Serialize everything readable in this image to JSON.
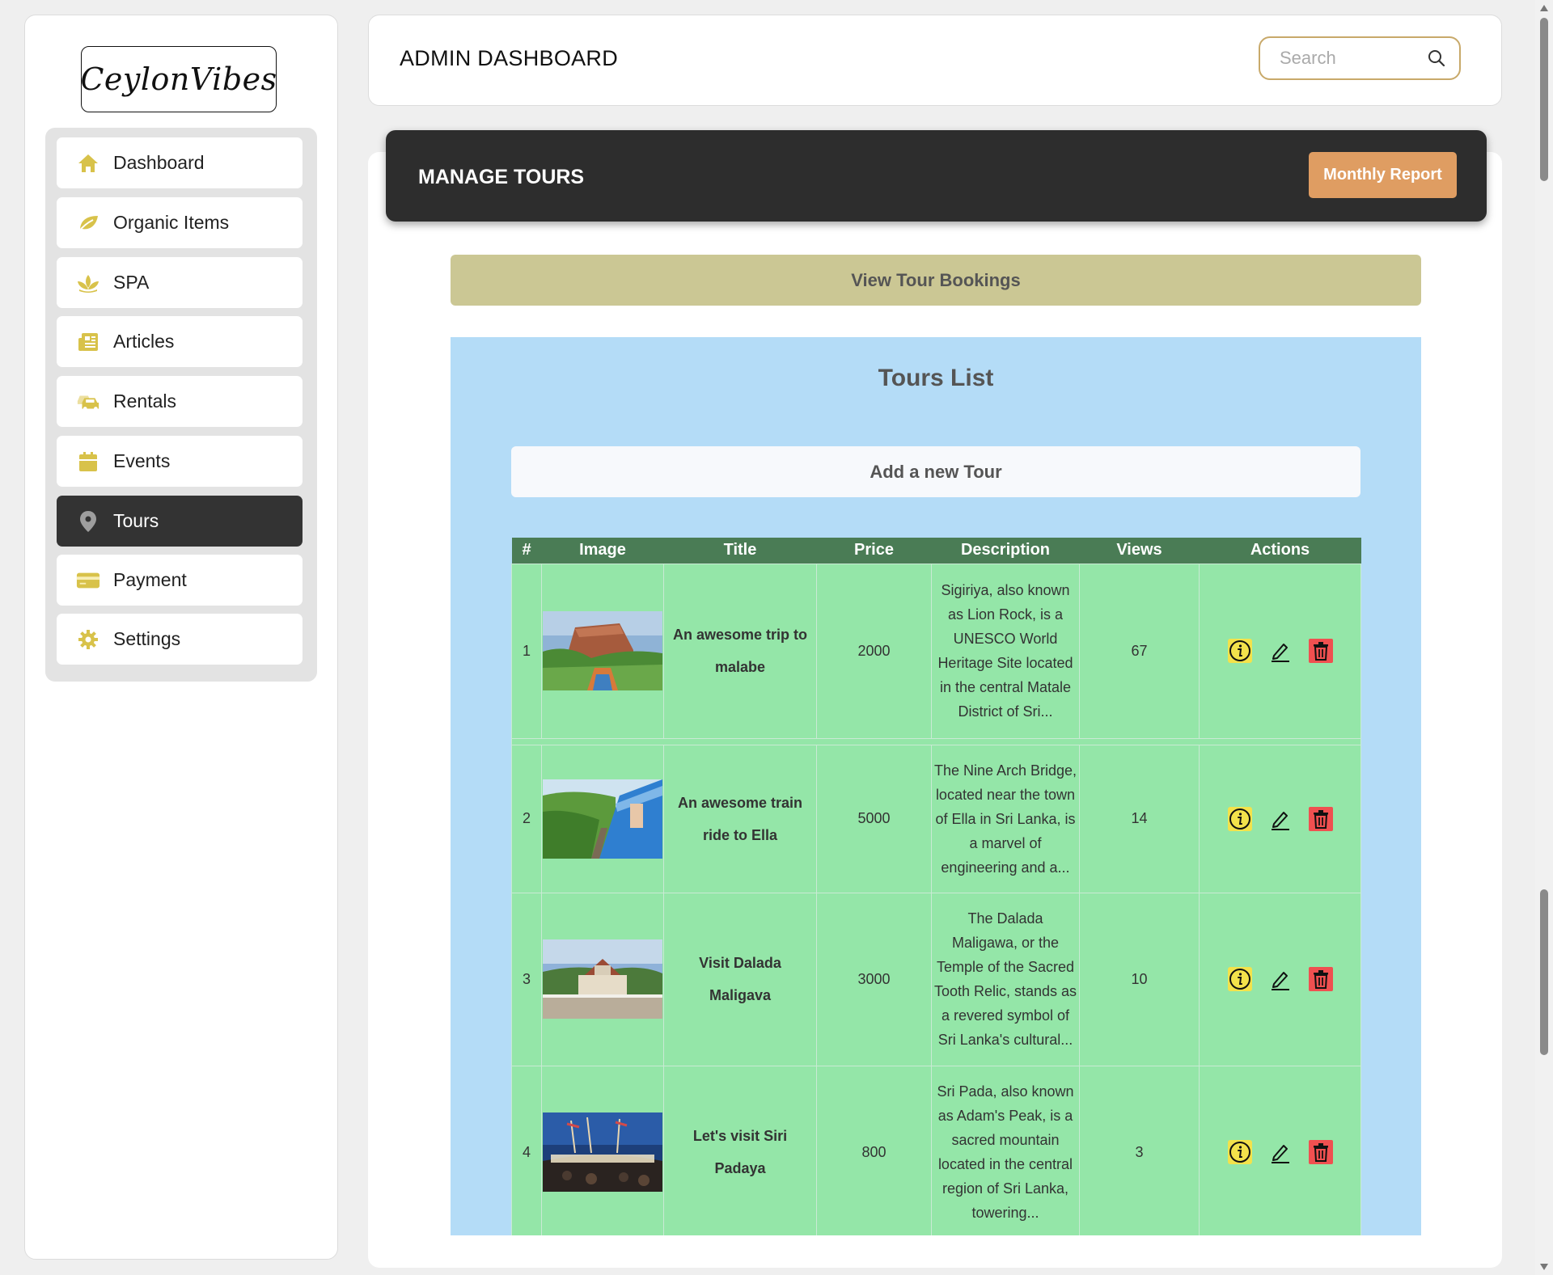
{
  "brand": {
    "logo_text": "CeylonVibes"
  },
  "sidebar": {
    "items": [
      {
        "label": "Dashboard",
        "icon": "home-icon",
        "active": false
      },
      {
        "label": "Organic Items",
        "icon": "leaf-icon",
        "active": false
      },
      {
        "label": "SPA",
        "icon": "lotus-icon",
        "active": false
      },
      {
        "label": "Articles",
        "icon": "newspaper-icon",
        "active": false
      },
      {
        "label": "Rentals",
        "icon": "car-icon",
        "active": false
      },
      {
        "label": "Events",
        "icon": "calendar-icon",
        "active": false
      },
      {
        "label": "Tours",
        "icon": "location-pin-icon",
        "active": true
      },
      {
        "label": "Payment",
        "icon": "credit-card-icon",
        "active": false
      },
      {
        "label": "Settings",
        "icon": "gear-icon",
        "active": false
      }
    ]
  },
  "header": {
    "title": "ADMIN DASHBOARD",
    "search_placeholder": "Search"
  },
  "manage": {
    "title": "MANAGE TOURS",
    "monthly_report_label": "Monthly Report"
  },
  "view_bookings_label": "View Tour Bookings",
  "tours_list": {
    "title": "Tours List",
    "add_label": "Add a new Tour",
    "columns": [
      "#",
      "Image",
      "Title",
      "Price",
      "Description",
      "Views",
      "Actions"
    ],
    "rows": [
      {
        "num": "1",
        "image": "sigiriya-photo",
        "title": "An awesome trip to malabe",
        "price": "2000",
        "description": "Sigiriya, also known as Lion Rock, is a UNESCO World Heritage Site located in the central Matale District of Sri...",
        "views": "67"
      },
      {
        "num": "2",
        "image": "train-ella-photo",
        "title": "An awesome train ride to Ella",
        "price": "5000",
        "description": "The Nine Arch Bridge, located near the town of Ella in Sri Lanka, is a marvel of engineering and a...",
        "views": "14"
      },
      {
        "num": "3",
        "image": "dalada-maligawa-photo",
        "title": "Visit Dalada Maligava",
        "price": "3000",
        "description": "The Dalada Maligawa, or the Temple of the Sacred Tooth Relic, stands as a revered symbol of Sri Lanka's cultural...",
        "views": "10"
      },
      {
        "num": "4",
        "image": "siri-padaya-photo",
        "title": "Let's visit Siri Padaya",
        "price": "800",
        "description": "Sri Pada, also known as Adam's Peak, is a sacred mountain located in the central region of Sri Lanka, towering...",
        "views": "3"
      }
    ]
  },
  "colors": {
    "accent_yellow": "#d8c24a",
    "active_nav": "#333333",
    "manage_bar": "#2d2d2d",
    "monthly_btn": "#df9d62",
    "bookings_btn": "#cbc794",
    "tours_bg": "#b4dcf7",
    "table_header": "#4a7c55",
    "table_row": "#94e6a8",
    "delete_red": "#f05050",
    "info_yellow": "#f3e24b"
  }
}
